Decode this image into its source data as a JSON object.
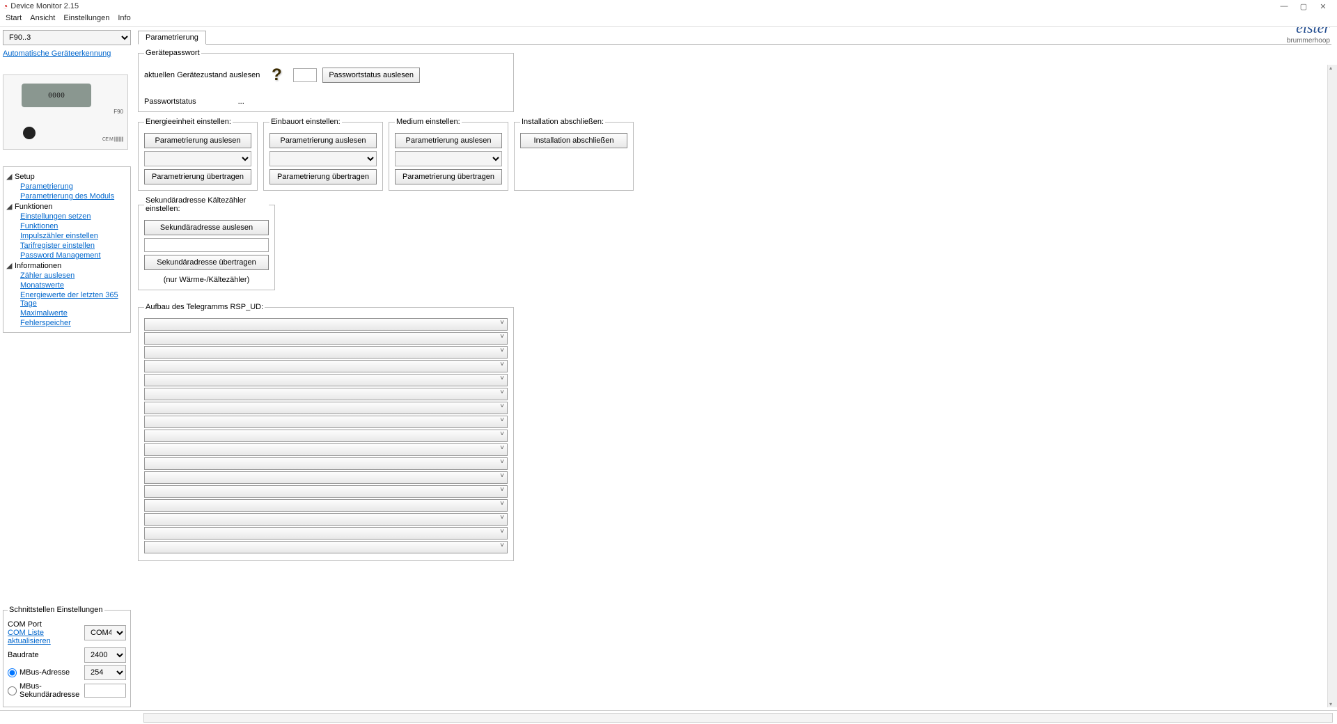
{
  "window": {
    "title": "Device Monitor 2.15"
  },
  "menu": {
    "start": "Start",
    "ansicht": "Ansicht",
    "einstellungen": "Einstellungen",
    "info": "Info"
  },
  "sidebar": {
    "device_select_value": "F90..3",
    "auto_detect": "Automatische Geräteerkennung",
    "device_image_label": "F90",
    "tree": {
      "setup": {
        "label": "Setup",
        "items": [
          "Parametrierung",
          "Parametrierung des Moduls"
        ]
      },
      "funktionen": {
        "label": "Funktionen",
        "items": [
          "Einstellungen setzen",
          "Funktionen",
          "Impulszähler einstellen",
          "Tarifregister einstellen",
          "Password Management"
        ]
      },
      "informationen": {
        "label": "Informationen",
        "items": [
          "Zähler auslesen",
          "Monatswerte",
          "Energiewerte der letzten 365 Tage",
          "Maximalwerte",
          "Fehlerspeicher"
        ]
      }
    },
    "iface": {
      "legend": "Schnittstellen Einstellungen",
      "com_port": "COM Port",
      "com_refresh": "COM Liste aktualisieren",
      "com_value": "COM4",
      "baud": "Baudrate",
      "baud_value": "2400",
      "mbus_addr": "MBus-Adresse",
      "mbus_addr_value": "254",
      "mbus_sec": "MBus-Sekundäradresse"
    }
  },
  "main": {
    "tab": "Parametrierung",
    "geraetepasswort": {
      "legend": "Gerätepasswort",
      "read_state": "aktuellen Gerätezustand auslesen",
      "btn": "Passwortstatus auslesen",
      "status_label": "Passwortstatus",
      "status_value": "..."
    },
    "energie": {
      "legend": "Energieeinheit einstellen:",
      "read": "Parametrierung auslesen",
      "write": "Parametrierung übertragen"
    },
    "einbauort": {
      "legend": "Einbauort einstellen:",
      "read": "Parametrierung auslesen",
      "write": "Parametrierung übertragen"
    },
    "medium": {
      "legend": "Medium einstellen:",
      "read": "Parametrierung auslesen",
      "write": "Parametrierung übertragen"
    },
    "install": {
      "legend": "Installation abschließen:",
      "btn": "Installation abschließen"
    },
    "sekaddr": {
      "legend": "Sekundäradresse Kältezähler einstellen:",
      "read": "Sekundäradresse auslesen",
      "write": "Sekundäradresse übertragen",
      "note": "(nur Wärme-/Kältezähler)"
    },
    "rsp": {
      "legend": "Aufbau des Telegramms RSP_UD:"
    }
  },
  "brand": {
    "name": "elster",
    "sub": "brummerhoop"
  }
}
